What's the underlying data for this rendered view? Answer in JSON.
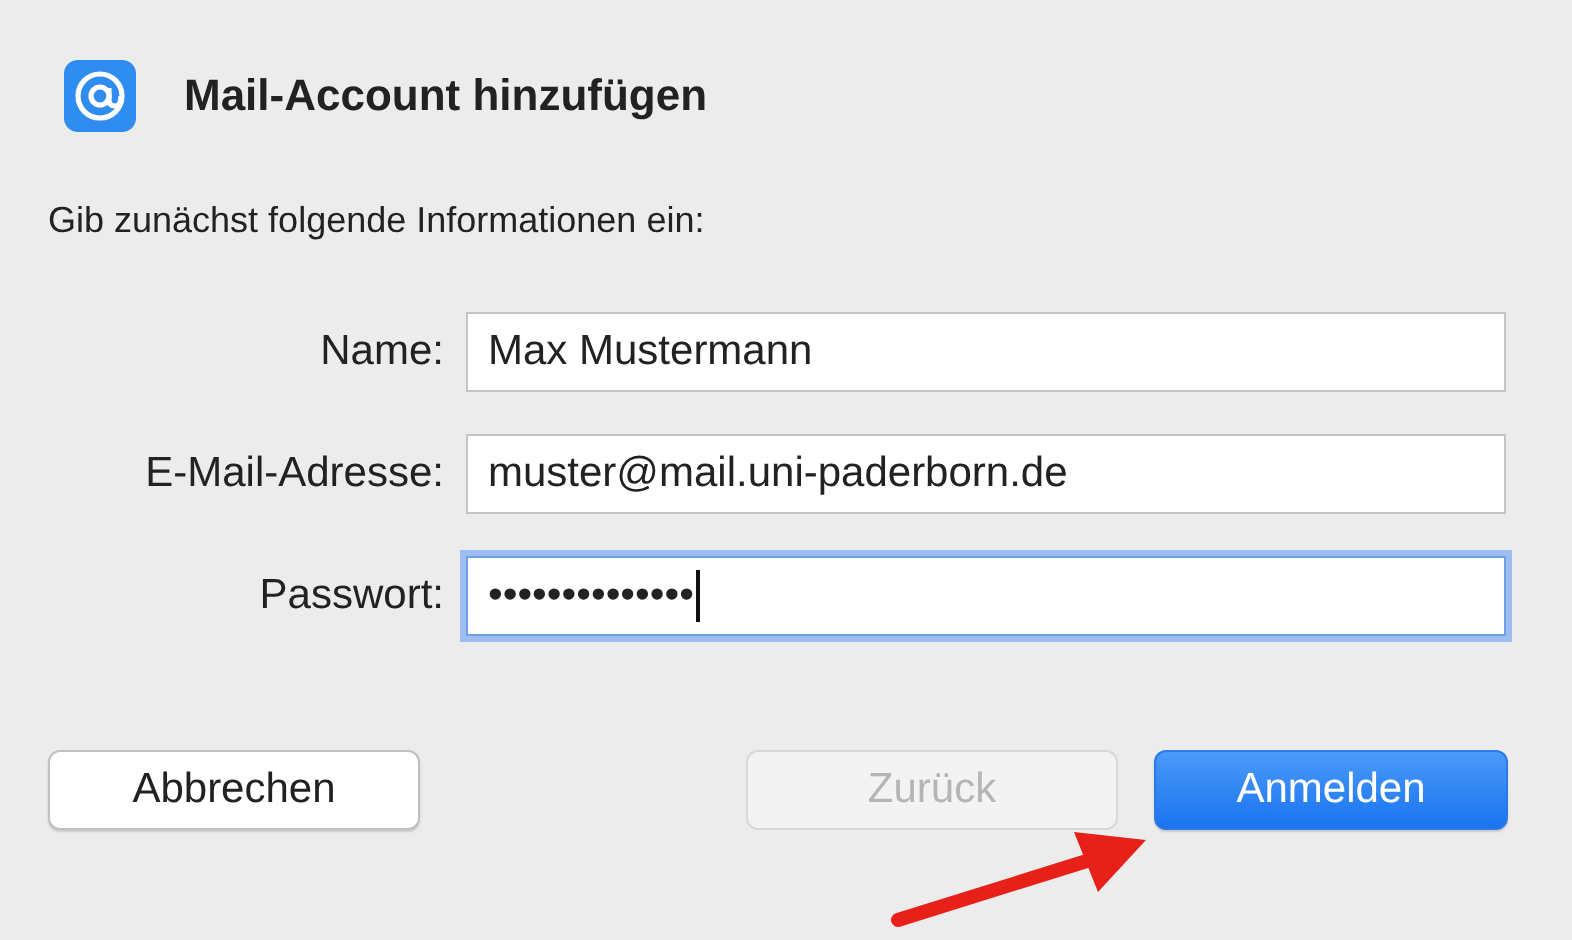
{
  "dialog": {
    "title": "Mail-Account hinzufügen",
    "intro": "Gib zunächst folgende Informationen ein:"
  },
  "fields": [
    {
      "label": "Name:",
      "value": "Max Mustermann",
      "focused": false
    },
    {
      "label": "E-Mail-Adresse:",
      "value": "muster@mail.uni-paderborn.de",
      "focused": false
    },
    {
      "label": "Passwort:",
      "value": "••••••••••••••",
      "focused": true
    }
  ],
  "buttons": [
    {
      "label": "Abbrechen",
      "kind": "plain",
      "disabled": false
    },
    {
      "label": "Zurück",
      "kind": "plain",
      "disabled": true
    },
    {
      "label": "Anmelden",
      "kind": "primary",
      "disabled": false
    }
  ]
}
